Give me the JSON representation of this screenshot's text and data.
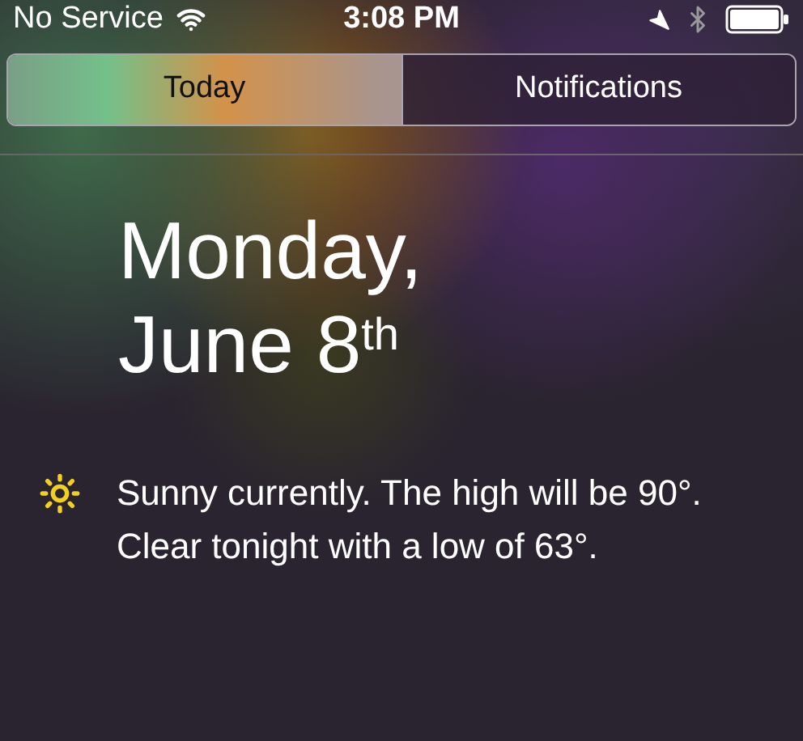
{
  "status_bar": {
    "carrier": "No Service",
    "time": "3:08 PM"
  },
  "tabs": [
    {
      "label": "Today",
      "selected": true
    },
    {
      "label": "Notifications",
      "selected": false
    }
  ],
  "date": {
    "line_1": "Monday,",
    "line_2": "June 8$^{th}$"
  },
  "weather": {
    "summary": "Sunny currently. The high will be 90°. Clear tonight with a low of 63°."
  }
}
